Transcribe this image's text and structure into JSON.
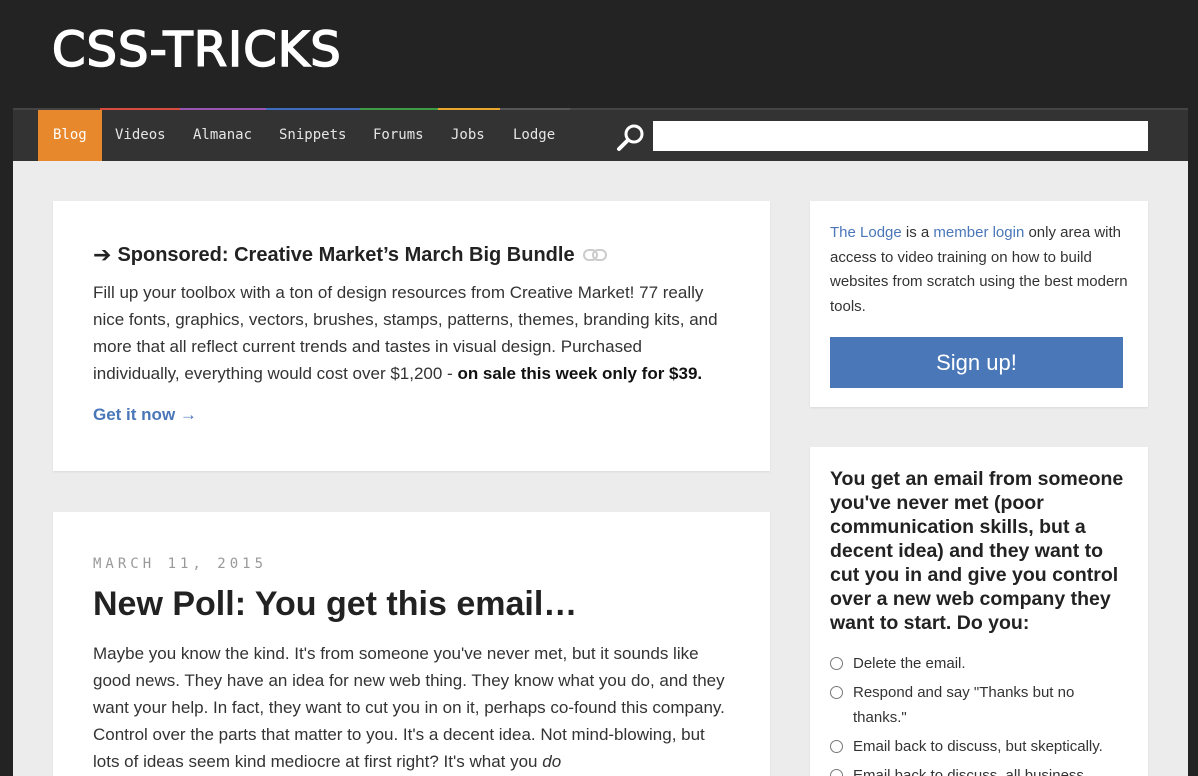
{
  "header": {
    "logo": "CSS-TRICKS"
  },
  "nav": {
    "items": [
      {
        "label": "Blog",
        "active": true,
        "accent": "#e8882c"
      },
      {
        "label": "Videos",
        "accent": "#d64b3b"
      },
      {
        "label": "Almanac",
        "accent": "#9a54b4"
      },
      {
        "label": "Snippets",
        "accent": "#3c6dbf"
      },
      {
        "label": "Forums",
        "accent": "#3f9c46"
      },
      {
        "label": "Jobs",
        "accent": "#e8a72c"
      },
      {
        "label": "Lodge",
        "accent": "#555555"
      }
    ],
    "search": {
      "placeholder": "",
      "value": ""
    }
  },
  "sponsor": {
    "title": "Sponsored: Creative Market’s March Big Bundle",
    "body": "Fill up your toolbox with a ton of design resources from Creative Market! 77 really nice fonts, graphics, vectors, brushes, stamps, patterns, themes, branding kits, and more that all reflect current trends and tastes in visual design. Purchased individually, everything would cost over $1,200 - ",
    "body_bold": "on sale this week only for $39.",
    "cta": "Get it now →"
  },
  "post": {
    "date": "MARCH 11, 2015",
    "title": "New Poll: You get this email…",
    "body": "Maybe you know the kind. It's from someone you've never met, but it sounds like good news. They have an idea for new web thing. They know what you do, and they want your help. In fact, they want to cut you in on it, perhaps co-found this company. Control over the parts that matter to you. It's a decent idea. Not mind-blowing, but lots of ideas seem kind mediocre at first right? It's what you ",
    "body_em": "do"
  },
  "lodge": {
    "link1": "The Lodge",
    "text1": " is a ",
    "link2": "member login",
    "text2": " only area with access to video training on how to build websites from scratch using the best modern tools.",
    "signup": "Sign up!"
  },
  "poll": {
    "question": "You get an email from someone you've never met (poor communication skills, but a decent idea) and they want to cut you in and give you control over a new web company they want to start. Do you:",
    "options": [
      "Delete the email.",
      "Respond and say \"Thanks but no thanks.\"",
      "Email back to discuss, but skeptically.",
      "Email back to discuss, all business"
    ]
  }
}
